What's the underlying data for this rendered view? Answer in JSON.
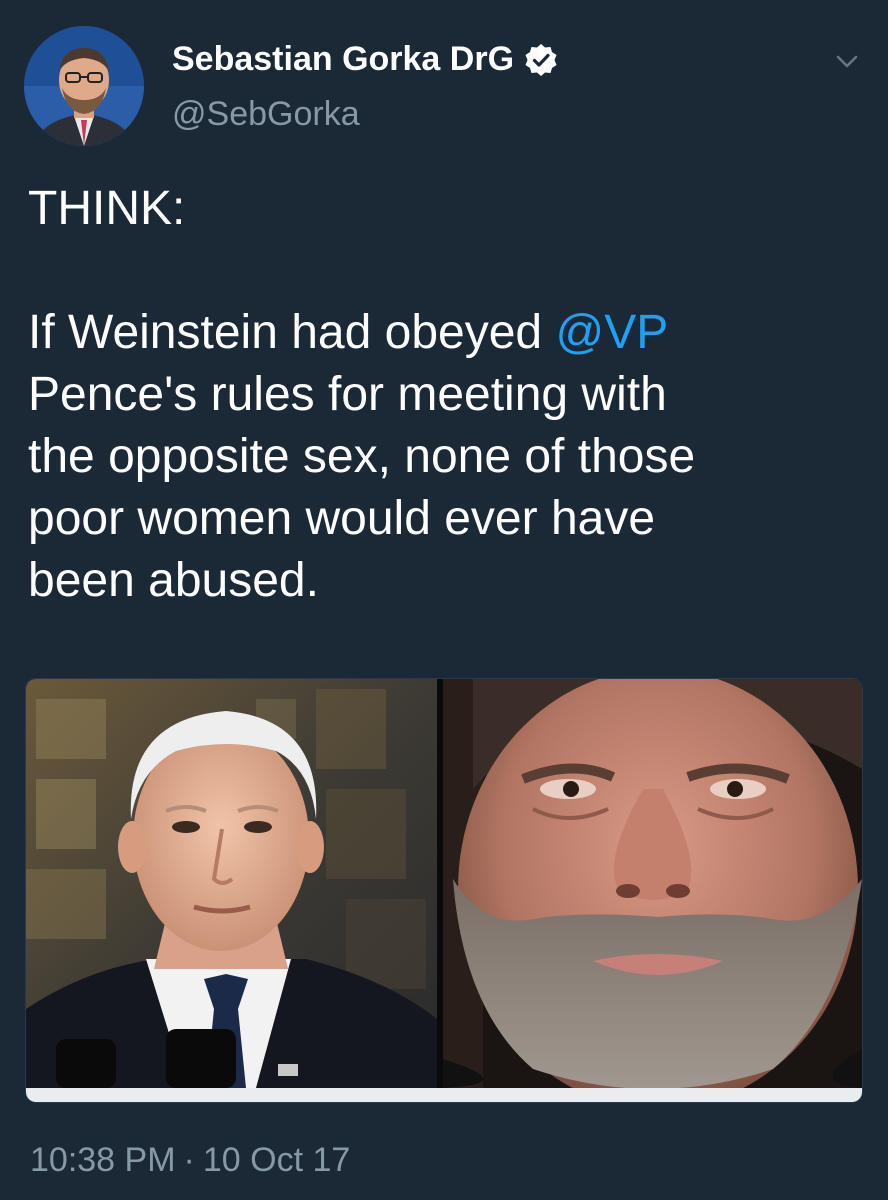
{
  "tweet": {
    "author": {
      "name": "Sebastian Gorka DrG",
      "handle": "@SebGorka",
      "verified": true,
      "avatar_icon": "profile-avatar"
    },
    "menu_icon": "chevron-down-icon",
    "text_lines": [
      [
        {
          "text": "THINK:"
        }
      ],
      [
        {
          "text": ""
        }
      ],
      [
        {
          "text": "If Weinstein had obeyed "
        },
        {
          "text": "@VP",
          "mention": true
        }
      ],
      [
        {
          "text": "Pence's rules for meeting with"
        }
      ],
      [
        {
          "text": "the opposite sex, none of those"
        }
      ],
      [
        {
          "text": "poor women would ever have"
        }
      ],
      [
        {
          "text": "been abused."
        }
      ]
    ],
    "media": {
      "left_photo": "portrait-photo-man-in-suit",
      "right_photo": "portrait-photo-bearded-man-closeup"
    },
    "time": "10:38 PM",
    "separator": "·",
    "date": "10 Oct 17"
  },
  "colors": {
    "background": "#1b2836",
    "text": "#ffffff",
    "secondary": "#8899a6",
    "mention": "#1da1f2"
  }
}
